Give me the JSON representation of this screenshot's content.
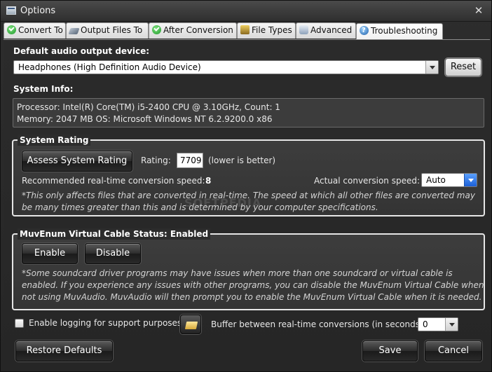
{
  "window": {
    "title": "Options",
    "close_glyph": "✕"
  },
  "tabs": [
    {
      "label": "Convert To",
      "icon": "check-icon"
    },
    {
      "label": "Output Files To",
      "icon": "output-files-icon"
    },
    {
      "label": "After Conversion",
      "icon": "check-icon"
    },
    {
      "label": "File Types",
      "icon": "file-types-icon"
    },
    {
      "label": "Advanced",
      "icon": "advanced-icon"
    },
    {
      "label": "Troubleshooting",
      "icon": "help-icon",
      "active": true
    }
  ],
  "audio": {
    "label": "Default audio output device:",
    "device": "Headphones (High Definition Audio Device)",
    "reset_label": "Reset"
  },
  "system_info": {
    "label": "System Info:",
    "line1": "Processor: Intel(R) Core(TM) i5-2400 CPU @ 3.10GHz, Count: 1",
    "line2": "Memory: 2047 MB OS: Microsoft Windows NT 6.2.9200.0 x86"
  },
  "rating": {
    "title": "System Rating",
    "assess_label": "Assess System Rating",
    "rating_label": "Rating:",
    "rating_value": "7709",
    "lower_better": "(lower is better)",
    "recommended_label": "Recommended real-time conversion speed:",
    "recommended_value": "8",
    "actual_label": "Actual conversion speed:",
    "actual_value": "Auto",
    "note": "*This only affects files that are converted in real-time.  The speed at which all other files are converted may be many times greater than this and is determined by your computer specifications."
  },
  "cable": {
    "title": "MuvEnum Virtual Cable Status: Enabled",
    "enable_label": "Enable",
    "disable_label": "Disable",
    "note": "*Some soundcard driver programs may have issues when more than one soundcard or virtual cable is enabled.  If you experience any issues with other programs, you can disable the MuvEnum Virtual Cable when not using MuvAudio.  MuvAudio will then prompt you to enable the MuvEnum Virtual Cable when it is needed."
  },
  "logging": {
    "label": "Enable logging for support purposes",
    "checked": false
  },
  "buffer": {
    "label": "Buffer between real-time conversions (in seconds):",
    "value": "0"
  },
  "footer": {
    "restore_label": "Restore Defaults",
    "save_label": "Save",
    "cancel_label": "Cancel"
  },
  "watermark": "SOFTPEDIA"
}
